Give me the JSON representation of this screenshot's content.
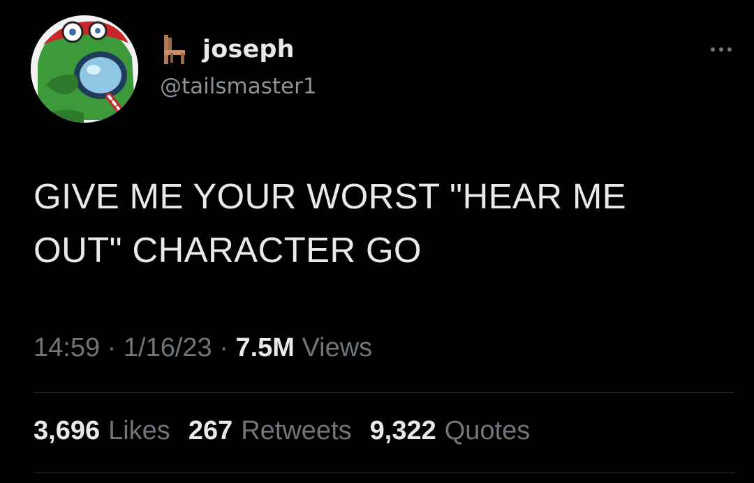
{
  "author": {
    "display_name": "joseph",
    "handle": "@tailsmaster1",
    "name_emoji_icon": "chair-icon",
    "avatar_icon": "green-character-with-magnifying-glass"
  },
  "tweet": {
    "text_line1": "GIVE ME YOUR WORST \"HEAR ME",
    "text_line2": "OUT\" CHARACTER GO"
  },
  "meta": {
    "time": "14:59",
    "separator": "·",
    "date": "1/16/23",
    "views_count": "7.5M",
    "views_label": "Views"
  },
  "stats": {
    "likes_count": "3,696",
    "likes_label": "Likes",
    "retweets_count": "267",
    "retweets_label": "Retweets",
    "quotes_count": "9,322",
    "quotes_label": "Quotes"
  },
  "colors": {
    "background": "#000000",
    "primary_text": "#e7e9ea",
    "secondary_text": "#71767b",
    "divider": "#2a2d30"
  }
}
